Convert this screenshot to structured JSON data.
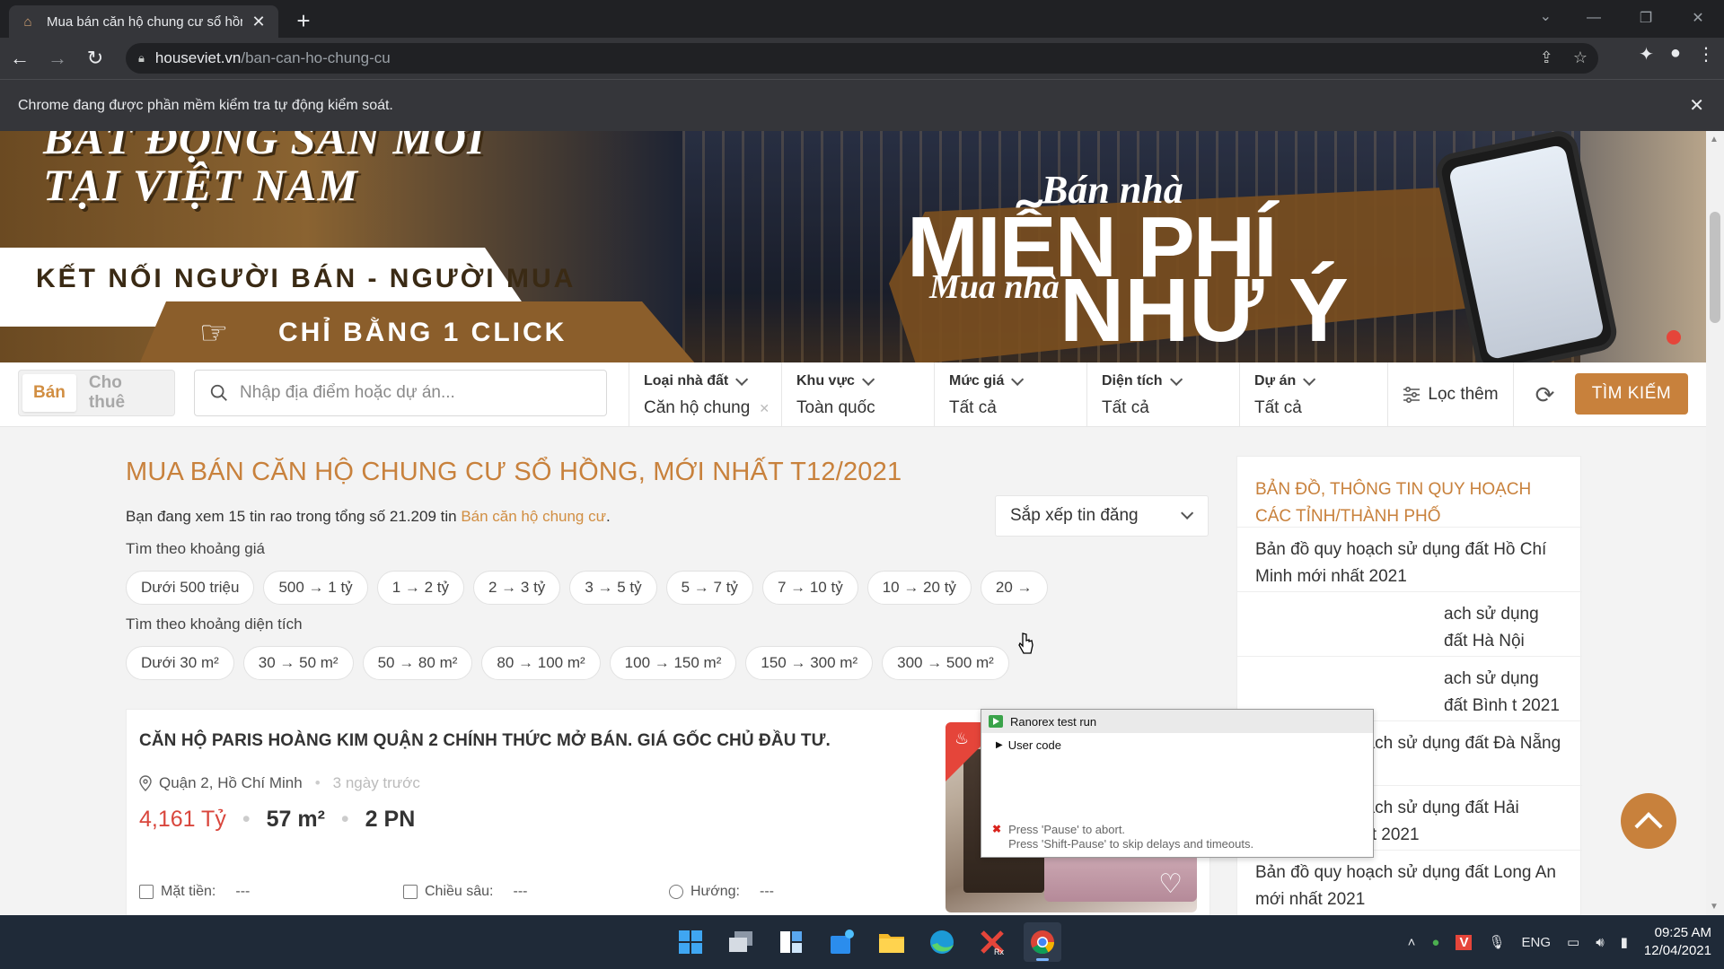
{
  "browser": {
    "tab_title": "Mua bán căn hộ chung cư sổ hồng",
    "tab_favicon": "house-logo-icon",
    "url_domain": "houseviet.vn",
    "url_path": "/ban-can-ho-chung-cu",
    "infobar_text": "Chrome đang được phần mềm kiểm tra tự động kiểm soát."
  },
  "banner": {
    "headline_line1": "BẤT ĐỘNG SẢN MỚI",
    "headline_line2": "TẠI VIỆT NAM",
    "connect": "KẾT NỐI NGƯỜI BÁN - NGƯỜI MUA",
    "click": "CHỈ BẰNG 1 CLICK",
    "sell": "Bán nhà",
    "free": "MIỄN PHÍ",
    "buy": "Mua nhà",
    "as_wish": "NHƯ Ý"
  },
  "search": {
    "mode_active": "Bán",
    "mode_inactive": "Cho thuê",
    "placeholder": "Nhập địa điểm hoặc dự án...",
    "filters": [
      {
        "label": "Loại nhà đất",
        "value": "Căn hộ chung",
        "clearable": true
      },
      {
        "label": "Khu vực",
        "value": "Toàn quốc"
      },
      {
        "label": "Mức giá",
        "value": "Tất cả"
      },
      {
        "label": "Diện tích",
        "value": "Tất cả"
      },
      {
        "label": "Dự án",
        "value": "Tất cả"
      }
    ],
    "more_filters": "Lọc thêm",
    "submit": "TÌM KIẾM"
  },
  "main": {
    "title": "MUA BÁN CĂN HỘ CHUNG CƯ SỔ HỒNG, MỚI NHẤT T12/2021",
    "summary_prefix": "Bạn đang xem 15 tin rao trong tổng số 21.209 tin",
    "summary_link": "Bán căn hộ chung cư",
    "summary_suffix": ".",
    "sort_label": "Sắp xếp tin đăng",
    "price_label": "Tìm theo khoảng giá",
    "price_chips": [
      "Dưới 500 triệu",
      "500 → 1 tỷ",
      "1 → 2 tỷ",
      "2 → 3 tỷ",
      "3 → 5 tỷ",
      "5 → 7 tỷ",
      "7 → 10 tỷ",
      "10 → 20 tỷ",
      "20 →"
    ],
    "area_label": "Tìm theo khoảng diện tích",
    "area_chips": [
      "Dưới 30 m²",
      "30 → 50 m²",
      "50 → 80 m²",
      "80 → 100 m²",
      "100 → 150 m²",
      "150 → 300 m²",
      "300 → 500 m²"
    ]
  },
  "listing": {
    "title": "CĂN HỘ PARIS HOÀNG KIM QUẬN 2 CHÍNH THỨC MỞ BÁN. GIÁ GỐC CHỦ ĐẦU TƯ.",
    "location": "Quận 2, Hồ Chí Minh",
    "posted": "3 ngày trước",
    "price": "4,161 Tỷ",
    "area": "57 m²",
    "rooms": "2 PN",
    "frontage_label": "Mặt tiền:",
    "frontage_value": "---",
    "depth_label": "Chiều sâu:",
    "depth_value": "---",
    "direction_label": "Hướng:",
    "direction_value": "---"
  },
  "sidebar": {
    "title": "BẢN ĐỒ, THÔNG TIN QUY HOẠCH CÁC TỈNH/THÀNH PHỐ",
    "items": [
      "Bản đồ quy hoạch sử dụng đất Hồ Chí Minh mới nhất 2021",
      "ach sử dụng đất Hà Nội",
      "ach sử dụng đất Bình t 2021",
      "Bản đồ quy hoạch sử dụng đất Đà Nẵng mới nhất 2021",
      "Bản đồ quy hoạch sử dụng đất Hải Phòng mới nhất 2021",
      "Bản đồ quy hoạch sử dụng đất Long An mới nhất 2021"
    ]
  },
  "ranorex": {
    "title": "Ranorex test run",
    "node": "User code",
    "hint1": "Press 'Pause' to abort.",
    "hint2": "Press 'Shift-Pause' to skip delays and timeouts."
  },
  "taskbar": {
    "lang": "ENG",
    "time": "09:25 AM",
    "date": "12/04/2021",
    "apps": [
      "windows-start-icon",
      "task-view-icon",
      "widgets-icon",
      "store-icon",
      "file-explorer-icon",
      "edge-icon",
      "ranorex-icon",
      "chrome-icon"
    ]
  },
  "colors": {
    "brand": "#c8813c",
    "price": "#d9463c"
  }
}
